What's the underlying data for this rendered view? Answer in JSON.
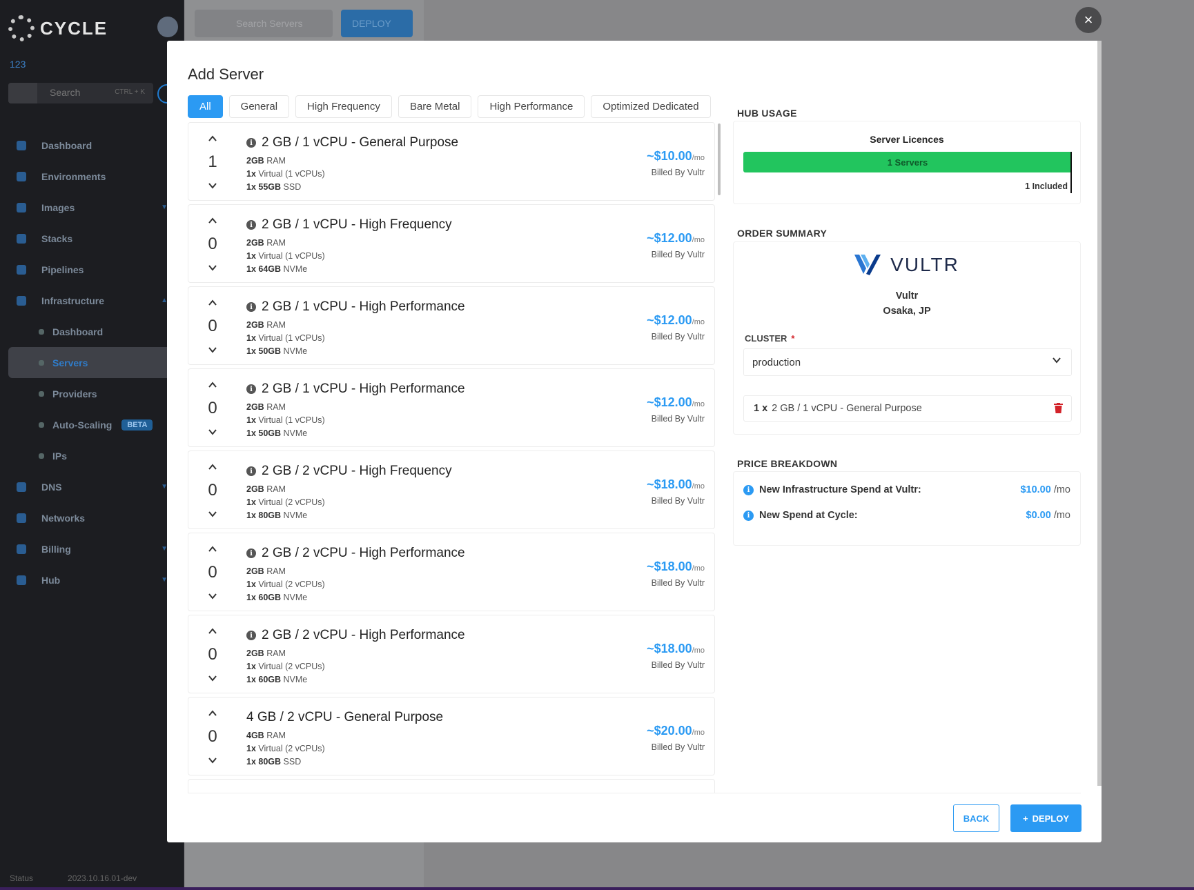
{
  "app": {
    "logo_text": "CYCLE",
    "hub_name": "123",
    "search_placeholder": "Search",
    "search_shortcut": "CTRL + K",
    "nav": [
      {
        "label": "Dashboard"
      },
      {
        "label": "Environments"
      },
      {
        "label": "Images"
      },
      {
        "label": "Stacks"
      },
      {
        "label": "Pipelines"
      },
      {
        "label": "Infrastructure"
      },
      {
        "label": "Dashboard"
      },
      {
        "label": "Servers"
      },
      {
        "label": "Providers"
      },
      {
        "label": "Auto-Scaling",
        "badge": "BETA"
      },
      {
        "label": "IPs"
      },
      {
        "label": "DNS"
      },
      {
        "label": "Networks"
      },
      {
        "label": "Billing"
      },
      {
        "label": "Hub"
      }
    ],
    "status_label": "Status",
    "version": "2023.10.16.01-dev",
    "top_search_placeholder": "Search Servers",
    "top_deploy_label": "DEPLOY"
  },
  "modal": {
    "title": "Add Server",
    "close_label": "×",
    "filters": [
      "All",
      "General",
      "High Frequency",
      "Bare Metal",
      "High Performance",
      "Optimized Dedicated"
    ],
    "active_filter": "All",
    "servers": [
      {
        "qty": "1",
        "name": "2 GB / 1 vCPU - General Purpose",
        "info": true,
        "ram": "2GB",
        "ram_unit": "RAM",
        "cpu_count": "1x",
        "cpu": "Virtual (1 vCPUs)",
        "disk_count": "1x",
        "disk": "55GB",
        "disk_type": "SSD",
        "price": "~$10.00",
        "per": "/mo",
        "billed": "Billed By Vultr"
      },
      {
        "qty": "0",
        "name": "2 GB / 1 vCPU - High Frequency",
        "info": true,
        "ram": "2GB",
        "ram_unit": "RAM",
        "cpu_count": "1x",
        "cpu": "Virtual (1 vCPUs)",
        "disk_count": "1x",
        "disk": "64GB",
        "disk_type": "NVMe",
        "price": "~$12.00",
        "per": "/mo",
        "billed": "Billed By Vultr"
      },
      {
        "qty": "0",
        "name": "2 GB / 1 vCPU - High Performance",
        "info": true,
        "ram": "2GB",
        "ram_unit": "RAM",
        "cpu_count": "1x",
        "cpu": "Virtual (1 vCPUs)",
        "disk_count": "1x",
        "disk": "50GB",
        "disk_type": "NVMe",
        "price": "~$12.00",
        "per": "/mo",
        "billed": "Billed By Vultr"
      },
      {
        "qty": "0",
        "name": "2 GB / 1 vCPU - High Performance",
        "info": true,
        "ram": "2GB",
        "ram_unit": "RAM",
        "cpu_count": "1x",
        "cpu": "Virtual (1 vCPUs)",
        "disk_count": "1x",
        "disk": "50GB",
        "disk_type": "NVMe",
        "price": "~$12.00",
        "per": "/mo",
        "billed": "Billed By Vultr"
      },
      {
        "qty": "0",
        "name": "2 GB / 2 vCPU - High Frequency",
        "info": true,
        "ram": "2GB",
        "ram_unit": "RAM",
        "cpu_count": "1x",
        "cpu": "Virtual (2 vCPUs)",
        "disk_count": "1x",
        "disk": "80GB",
        "disk_type": "NVMe",
        "price": "~$18.00",
        "per": "/mo",
        "billed": "Billed By Vultr"
      },
      {
        "qty": "0",
        "name": "2 GB / 2 vCPU - High Performance",
        "info": true,
        "ram": "2GB",
        "ram_unit": "RAM",
        "cpu_count": "1x",
        "cpu": "Virtual (2 vCPUs)",
        "disk_count": "1x",
        "disk": "60GB",
        "disk_type": "NVMe",
        "price": "~$18.00",
        "per": "/mo",
        "billed": "Billed By Vultr"
      },
      {
        "qty": "0",
        "name": "2 GB / 2 vCPU - High Performance",
        "info": true,
        "ram": "2GB",
        "ram_unit": "RAM",
        "cpu_count": "1x",
        "cpu": "Virtual (2 vCPUs)",
        "disk_count": "1x",
        "disk": "60GB",
        "disk_type": "NVMe",
        "price": "~$18.00",
        "per": "/mo",
        "billed": "Billed By Vultr"
      },
      {
        "qty": "0",
        "name": "4 GB / 2 vCPU - General Purpose",
        "info": false,
        "ram": "4GB",
        "ram_unit": "RAM",
        "cpu_count": "1x",
        "cpu": "Virtual (2 vCPUs)",
        "disk_count": "1x",
        "disk": "80GB",
        "disk_type": "SSD",
        "price": "~$20.00",
        "per": "/mo",
        "billed": "Billed By Vultr"
      }
    ],
    "hub_usage": {
      "heading": "HUB USAGE",
      "title": "Server Licences",
      "bar_label": "1 Servers",
      "used": 1,
      "included_label": "1 Included",
      "bar_color": "#22c55e"
    },
    "order_summary": {
      "heading": "ORDER SUMMARY",
      "provider_logo_text": "VULTR",
      "provider": "Vultr",
      "location": "Osaka, JP",
      "cluster_label": "CLUSTER",
      "cluster_required": "*",
      "cluster_value": "production",
      "item_qty": "1 x",
      "item_name": "2 GB / 1 vCPU - General Purpose"
    },
    "price_breakdown": {
      "heading": "PRICE BREAKDOWN",
      "rows": [
        {
          "label": "New Infrastructure Spend at Vultr:",
          "value": "$10.00",
          "unit": "/mo"
        },
        {
          "label": "New Spend at Cycle:",
          "value": "$0.00",
          "unit": "/mo"
        }
      ]
    },
    "back_label": "BACK",
    "deploy_label": "DEPLOY",
    "accent_color": "#2b9af3"
  }
}
